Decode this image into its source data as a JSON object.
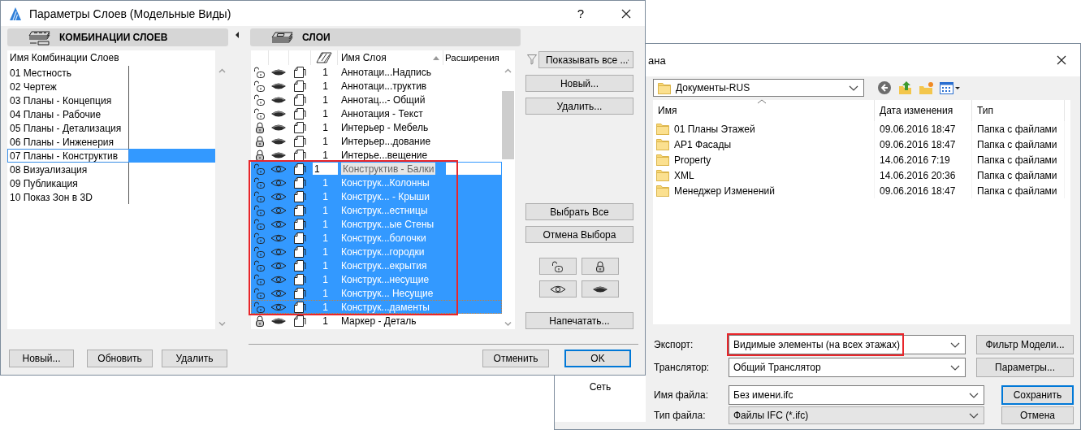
{
  "layer_settings_dialog": {
    "title": "Параметры Слоев (Модельные Виды)",
    "help": "?",
    "combinations_panel": {
      "title": "КОМБИНАЦИИ СЛОЕВ",
      "column": "Имя Комбинации Слоев",
      "items": [
        {
          "name": "01 Местность",
          "selected": false
        },
        {
          "name": "02 Чертеж",
          "selected": false
        },
        {
          "name": "03 Планы - Концепция",
          "selected": false
        },
        {
          "name": "04 Планы - Рабочие",
          "selected": false
        },
        {
          "name": "05 Планы - Детализация",
          "selected": false
        },
        {
          "name": "06 Планы - Инженерия",
          "selected": false
        },
        {
          "name": "07 Планы - Конструктив",
          "selected": true
        },
        {
          "name": "08 Визуализация",
          "selected": false
        },
        {
          "name": "09 Публикация",
          "selected": false
        },
        {
          "name": "10 Показ Зон в 3D",
          "selected": false
        }
      ],
      "buttons": [
        "Новый...",
        "Обновить",
        "Удалить"
      ]
    },
    "layers_panel": {
      "title": "СЛОИ",
      "columns": [
        "Имя Слоя",
        "Расширения"
      ],
      "rows": [
        {
          "locked": false,
          "visible": false,
          "pen": "1",
          "name": "Аннотаци...Надпись",
          "selected": false,
          "editing": false,
          "highlighted": false
        },
        {
          "locked": false,
          "visible": false,
          "pen": "1",
          "name": "Аннотаци...труктив",
          "selected": false,
          "editing": false,
          "highlighted": false
        },
        {
          "locked": false,
          "visible": false,
          "pen": "1",
          "name": "Аннотац...- Общий",
          "selected": false,
          "editing": false,
          "highlighted": false
        },
        {
          "locked": false,
          "visible": false,
          "pen": "1",
          "name": "Аннотация - Текст",
          "selected": false,
          "editing": false,
          "highlighted": false
        },
        {
          "locked": true,
          "visible": false,
          "pen": "1",
          "name": "Интерьер - Мебель",
          "selected": false,
          "editing": false,
          "highlighted": false
        },
        {
          "locked": true,
          "visible": false,
          "pen": "1",
          "name": "Интерьер...дование",
          "selected": false,
          "editing": false,
          "highlighted": false
        },
        {
          "locked": true,
          "visible": false,
          "pen": "1",
          "name": "Интерье...вещение",
          "selected": false,
          "editing": false,
          "highlighted": false
        },
        {
          "locked": false,
          "visible": true,
          "pen": "1",
          "name": "Конструктив - Балки",
          "selected": true,
          "editing": true,
          "highlighted": true
        },
        {
          "locked": false,
          "visible": true,
          "pen": "1",
          "name": "Конструк...Колонны",
          "selected": true,
          "editing": false,
          "highlighted": true
        },
        {
          "locked": false,
          "visible": true,
          "pen": "1",
          "name": "Конструк... - Крыши",
          "selected": true,
          "editing": false,
          "highlighted": true
        },
        {
          "locked": false,
          "visible": true,
          "pen": "1",
          "name": "Конструк...естницы",
          "selected": true,
          "editing": false,
          "highlighted": true
        },
        {
          "locked": false,
          "visible": true,
          "pen": "1",
          "name": "Конструк...ые Стены",
          "selected": true,
          "editing": false,
          "highlighted": true
        },
        {
          "locked": false,
          "visible": true,
          "pen": "1",
          "name": "Конструк...болочки",
          "selected": true,
          "editing": false,
          "highlighted": true
        },
        {
          "locked": false,
          "visible": true,
          "pen": "1",
          "name": "Конструк...городки",
          "selected": true,
          "editing": false,
          "highlighted": true
        },
        {
          "locked": false,
          "visible": true,
          "pen": "1",
          "name": "Конструк...екрытия",
          "selected": true,
          "editing": false,
          "highlighted": true
        },
        {
          "locked": false,
          "visible": true,
          "pen": "1",
          "name": "Конструк...несущие",
          "selected": true,
          "editing": false,
          "highlighted": true
        },
        {
          "locked": false,
          "visible": true,
          "pen": "1",
          "name": "Конструк... Несущие",
          "selected": true,
          "editing": false,
          "highlighted": true
        },
        {
          "locked": false,
          "visible": true,
          "pen": "1",
          "name": "Конструк...даменты",
          "selected": true,
          "editing": false,
          "highlighted": true
        },
        {
          "locked": true,
          "visible": false,
          "pen": "1",
          "name": "Маркер - Деталь",
          "selected": false,
          "editing": false,
          "highlighted": false
        }
      ]
    },
    "side_buttons": {
      "filter": "Показывать все ...",
      "top": [
        "Новый...",
        "Удалить..."
      ],
      "selection": [
        "Выбрать Все",
        "Отмена Выбора"
      ],
      "print": "Напечатать..."
    },
    "footer_buttons": [
      {
        "label": "Отменить",
        "default": false
      },
      {
        "label": "OK",
        "default": true
      }
    ]
  },
  "save_dialog": {
    "title": "ана",
    "location": "Документы-RUS",
    "nav_items": [
      "Сеть"
    ],
    "columns": [
      "Имя",
      "Дата изменения",
      "Тип"
    ],
    "files": [
      {
        "name": "01 Планы Этажей",
        "modified": "09.06.2016 18:47",
        "type": "Папка с файлами"
      },
      {
        "name": "АР1 Фасады",
        "modified": "09.06.2016 18:47",
        "type": "Папка с файлами"
      },
      {
        "name": "Property",
        "modified": "14.06.2016 7:19",
        "type": "Папка с файлами"
      },
      {
        "name": "XML",
        "modified": "14.06.2016 20:36",
        "type": "Папка с файлами"
      },
      {
        "name": "Менеджер Изменений",
        "modified": "09.06.2016 18:47",
        "type": "Папка с файлами"
      }
    ],
    "fields": [
      {
        "kind": "option",
        "label": "Экспорт:",
        "value": "Видимые элементы (на всех этажах)",
        "readonly": false,
        "highlighted": true,
        "button": {
          "label": "Фильтр Модели...",
          "default": false
        }
      },
      {
        "kind": "option",
        "label": "Транслятор:",
        "value": "Общий Транслятор",
        "readonly": false,
        "highlighted": false,
        "button": {
          "label": "Параметры...",
          "default": false
        }
      },
      {
        "kind": "file",
        "label": "Имя файла:",
        "value": "Без имени.ifc",
        "readonly": false,
        "highlighted": false,
        "button": {
          "label": "Сохранить",
          "default": true
        }
      },
      {
        "kind": "file",
        "label": "Тип файла:",
        "value": "Файлы IFC (*.ifc)",
        "readonly": true,
        "highlighted": false,
        "button": {
          "label": "Отмена",
          "default": false
        }
      }
    ]
  }
}
